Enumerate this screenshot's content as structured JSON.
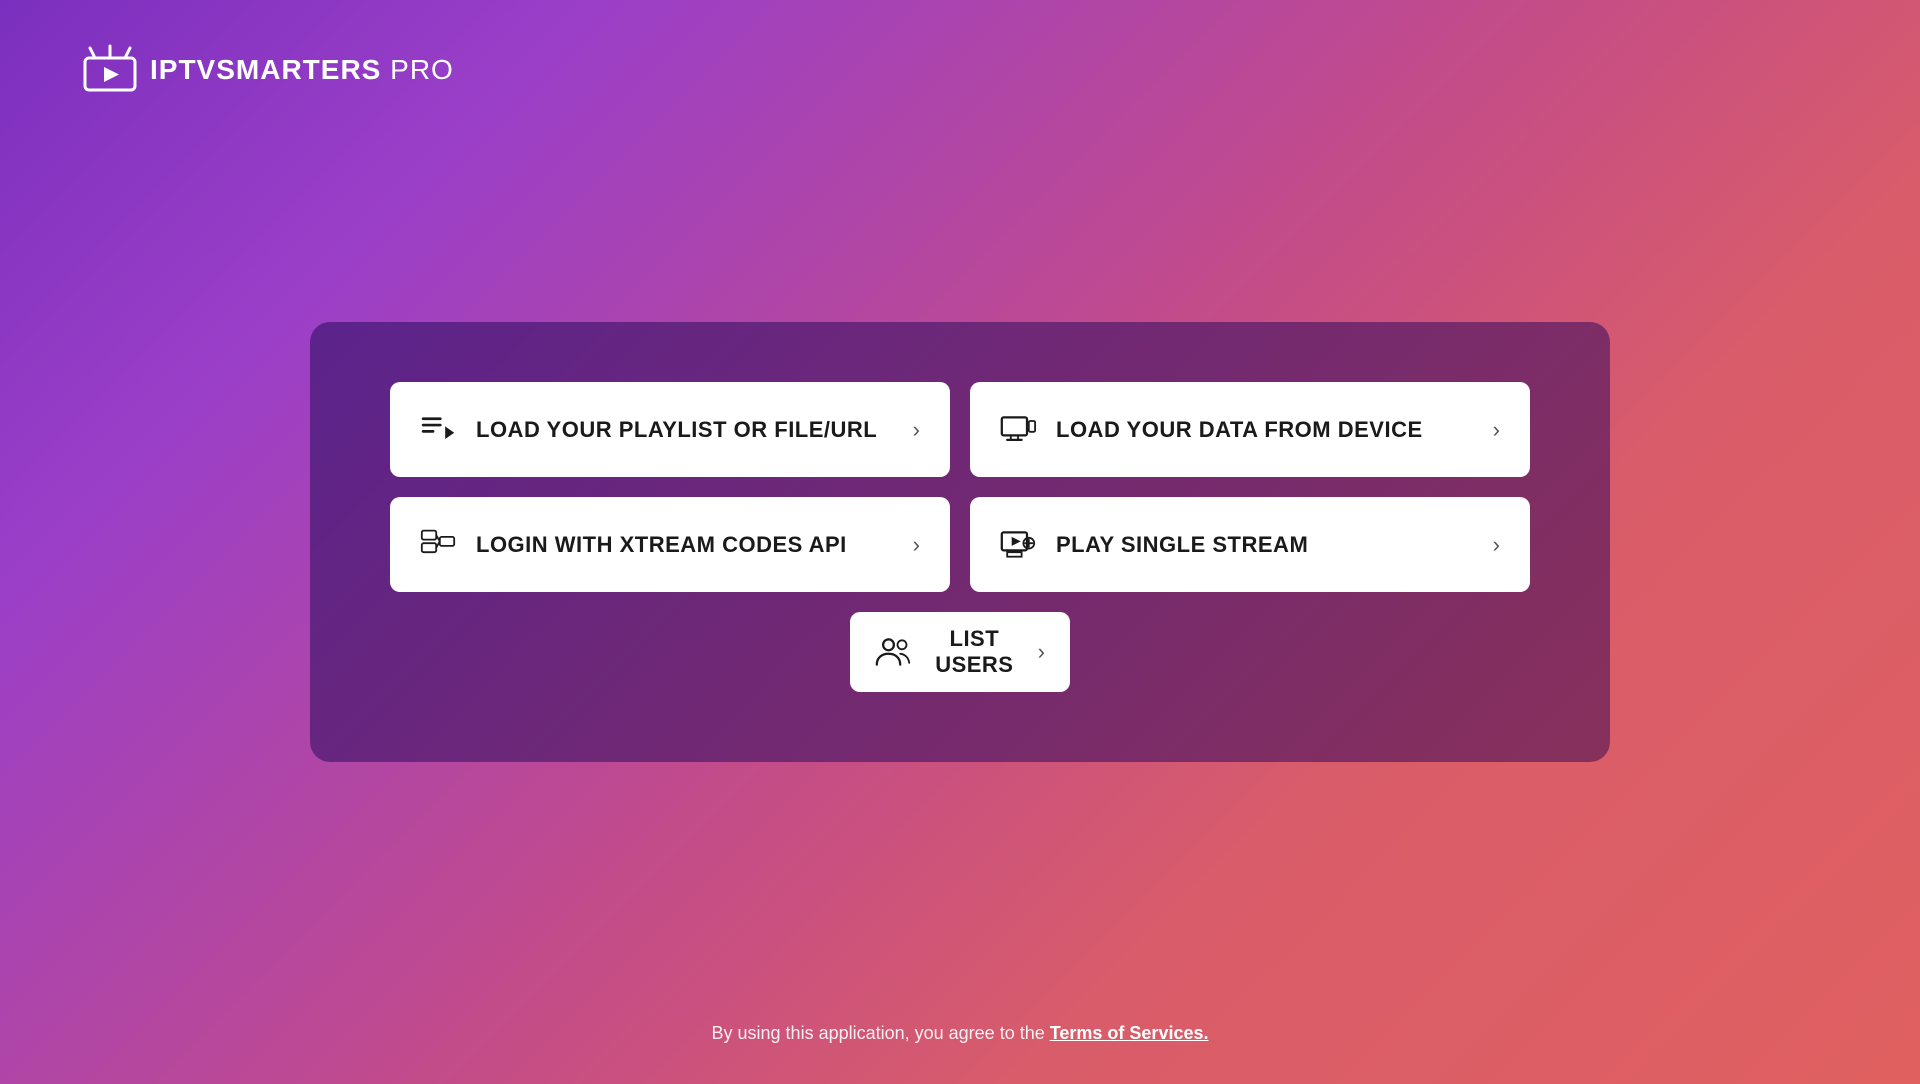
{
  "logo": {
    "brand": "IPTV",
    "name": "SMARTERS",
    "suffix": " PRO"
  },
  "buttons": [
    {
      "id": "load-playlist",
      "label": "LOAD YOUR PLAYLIST OR FILE/URL",
      "icon": "playlist-icon"
    },
    {
      "id": "load-device",
      "label": "LOAD YOUR DATA FROM DEVICE",
      "icon": "device-icon"
    },
    {
      "id": "login-xtream",
      "label": "LOGIN WITH XTREAM CODES API",
      "icon": "api-icon"
    },
    {
      "id": "play-single",
      "label": "PLAY SINGLE STREAM",
      "icon": "stream-icon"
    }
  ],
  "center_button": {
    "id": "list-users",
    "label": "LIST USERS",
    "icon": "users-icon"
  },
  "footer": {
    "text": "By using this application, you agree to the ",
    "link_text": "Terms of Services."
  }
}
